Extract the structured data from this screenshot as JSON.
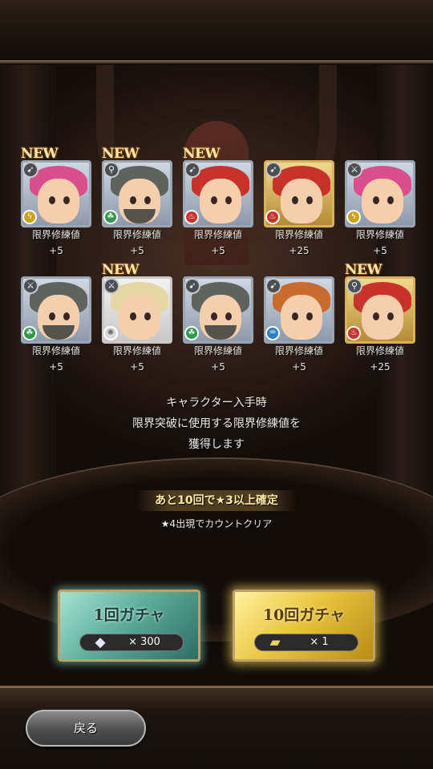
{
  "results": [
    {
      "new": true,
      "name_label": "限界修練値",
      "value": "+5",
      "hair": "pink",
      "frame": "silver",
      "weapon": "bow",
      "element": "thunder",
      "beard": false
    },
    {
      "new": true,
      "name_label": "限界修練値",
      "value": "+5",
      "hair": "gray",
      "frame": "silver",
      "weapon": "staff",
      "element": "wind",
      "beard": true
    },
    {
      "new": true,
      "name_label": "限界修練値",
      "value": "+5",
      "hair": "red",
      "frame": "silver",
      "weapon": "bow",
      "element": "fire",
      "beard": false
    },
    {
      "new": false,
      "name_label": "限界修練値",
      "value": "+25",
      "hair": "red",
      "frame": "gold",
      "weapon": "bow",
      "element": "fire",
      "beard": false
    },
    {
      "new": false,
      "name_label": "限界修練値",
      "value": "+5",
      "hair": "pink",
      "frame": "silver",
      "weapon": "sword",
      "element": "thunder",
      "beard": false
    },
    {
      "new": false,
      "name_label": "限界修練値",
      "value": "+5",
      "hair": "gray",
      "frame": "silver",
      "weapon": "sword",
      "element": "wind",
      "beard": true
    },
    {
      "new": true,
      "name_label": "限界修練値",
      "value": "+5",
      "hair": "blonde",
      "frame": "white",
      "weapon": "sword",
      "element": "light",
      "beard": false
    },
    {
      "new": false,
      "name_label": "限界修練値",
      "value": "+5",
      "hair": "gray",
      "frame": "silver",
      "weapon": "bow",
      "element": "wind",
      "beard": true
    },
    {
      "new": false,
      "name_label": "限界修練値",
      "value": "+5",
      "hair": "orange",
      "frame": "silver",
      "weapon": "bow",
      "element": "water",
      "beard": false
    },
    {
      "new": true,
      "name_label": "限界修練値",
      "value": "+25",
      "hair": "red",
      "frame": "gold",
      "weapon": "staff",
      "element": "fire",
      "beard": false
    }
  ],
  "new_label": "NEW",
  "info": {
    "line1": "キャラクター入手時",
    "line2": "限界突破に使用する限界修練値を",
    "line3": "獲得します"
  },
  "guarantee": "あと10回で★3以上確定",
  "reset_note": "★4出現でカウントクリア",
  "gacha": {
    "single": {
      "title": "1回ガチャ",
      "cost": "× 300",
      "icon": "crystal-icon"
    },
    "multi": {
      "title": "10回ガチャ",
      "cost": "× 1",
      "icon": "ticket-icon"
    }
  },
  "back_label": "戻る"
}
